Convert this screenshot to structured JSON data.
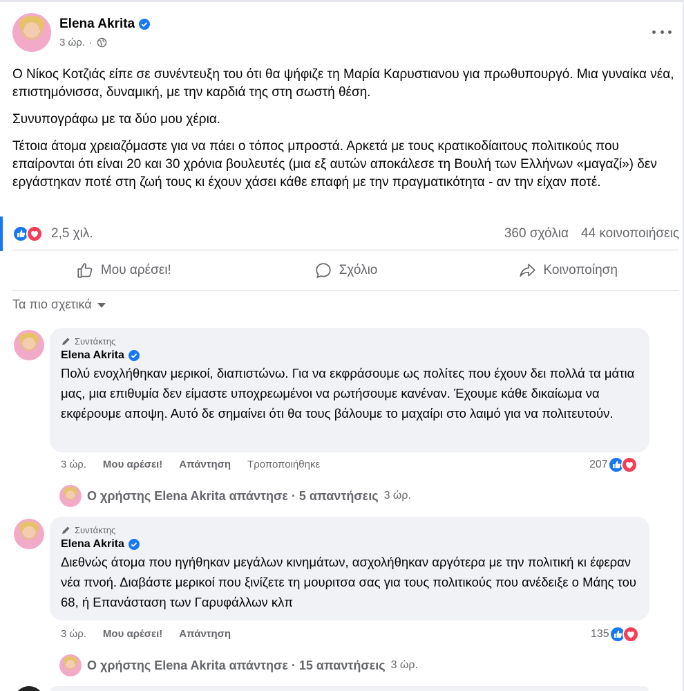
{
  "post": {
    "author": "Elena Akrita",
    "time": "3 ώρ.",
    "paragraphs": [
      "Ο Νίκος Κοτζιάς είπε σε συνέντευξη του ότι θα ψήφιζε τη Μαρία Καρυστιανου για πρωθυπουργό. Μια γυναίκα νέα, επιστημόνισσα, δυναμική, με την καρδιά της στη σωστή θέση.",
      "Συνυπογράφω με τα δύο μου χέρια.",
      "Τέτοια άτομα χρειαζόμαστε για να πάει ο τόπος μπροστά. Αρκετά με τους κρατικοδίαιτους πολιτικούς που επαίρονται ότι είναι 20 και 30 χρόνια βουλευτές (μια εξ αυτών αποκάλεσε τη Βουλή των Ελλήνων «μαγαζί») δεν εργάστηκαν ποτέ στη ζωή τους κι έχουν χάσει κάθε επαφή με την πραγματικότητα - αν την είχαν ποτέ."
    ],
    "reactions_count": "2,5 χιλ.",
    "comments_count": "360 σχόλια",
    "shares_count": "44 κοινοποιήσεις"
  },
  "actions": {
    "like": "Μου αρέσει!",
    "comment": "Σχόλιο",
    "share": "Κοινοποίηση"
  },
  "sort_label": "Τα πιο σχετικά",
  "comments": [
    {
      "badge": "Συντάκτης",
      "author": "Elena Akrita",
      "text": "Πολύ ενοχλήθηκαν μερικοί, διαπιστώνω. Για να εκφράσουμε ως πολίτες που έχουν δει πολλά τα μάτια μας, μια επιθυμία δεν είμαστε υποχρεωμένοι να ρωτήσουμε κανέναν. Έχουμε κάθε δικαίωμα να εκφέρουμε αποψη. Αυτό δε σημαίνει ότι θα τους βάλουμε το μαχαίρι στο λαιμό για να πολιτευτούν.",
      "time": "3 ώρ.",
      "like": "Μου αρέσει!",
      "reply": "Απάντηση",
      "edited": "Τροποποιήθηκε",
      "reactions": "207",
      "replies_summary": "Ο χρήστης Elena Akrita απάντησε · 5 απαντήσεις",
      "replies_time": "3 ώρ."
    },
    {
      "badge": "Συντάκτης",
      "author": "Elena Akrita",
      "text": "Διεθνώς άτομα που ηγήθηκαν μεγάλων κινημάτων, ασχολήθηκαν αργότερα με την πολιτική κι έφεραν νέα πνοή. Διαβάστε μερικοί που ξινίζετε τη μουριτσα σας για τους πολιτικούς που ανέδειξε ο Μάης του 68, ή Επανάσταση των Γαρυφάλλων κλπ",
      "time": "3 ώρ.",
      "like": "Μου αρέσει!",
      "reply": "Απάντηση",
      "reactions": "135",
      "replies_summary": "Ο χρήστης Elena Akrita απάντησε · 15 απαντήσεις",
      "replies_time": "3 ώρ."
    }
  ],
  "colors": {
    "brand": "#1877f2",
    "love": "#f33e58",
    "secondary_text": "#65676b",
    "bubble": "#f0f2f5"
  },
  "icons": [
    "verified-icon",
    "globe-icon",
    "more-icon",
    "like-reaction-icon",
    "love-reaction-icon",
    "thumb-up-icon",
    "comment-icon",
    "share-icon",
    "pencil-icon",
    "caret-down-icon"
  ]
}
